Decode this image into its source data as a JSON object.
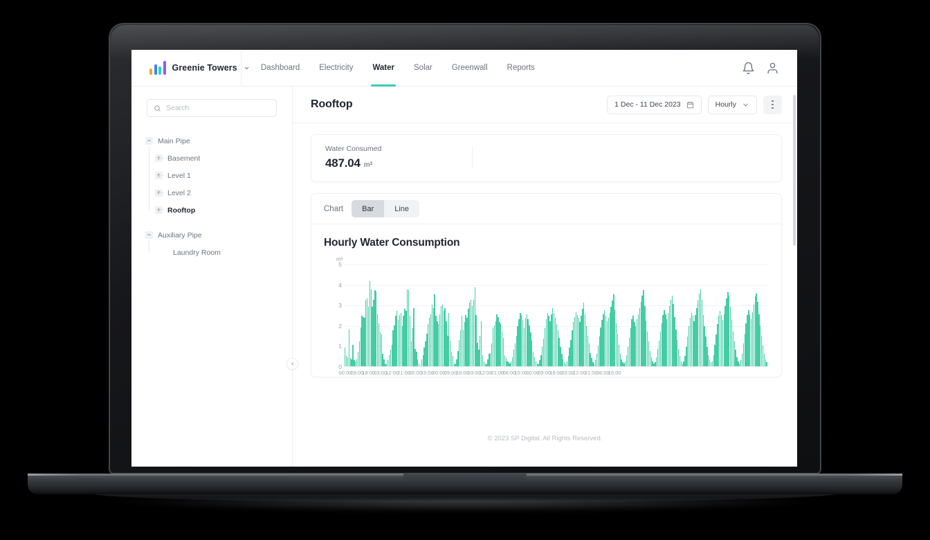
{
  "brand": {
    "name": "Greenie Towers",
    "caret_icon": "chevron-down-icon",
    "logo_icon": "bar-logo-icon"
  },
  "nav": {
    "links": [
      {
        "label": "Dashboard",
        "active": false
      },
      {
        "label": "Electricity",
        "active": false
      },
      {
        "label": "Water",
        "active": true
      },
      {
        "label": "Solar",
        "active": false
      },
      {
        "label": "Greenwall",
        "active": false
      },
      {
        "label": "Reports",
        "active": false
      }
    ],
    "notification_icon": "bell-icon",
    "account_icon": "user-icon"
  },
  "sidebar": {
    "search": {
      "placeholder": "Search",
      "value": "",
      "icon": "search-icon"
    },
    "tree": [
      {
        "label": "Main Pipe",
        "expander": "−",
        "selected": false,
        "children": [
          {
            "label": "Basement",
            "expander": "+",
            "selected": false
          },
          {
            "label": "Level 1",
            "expander": "+",
            "selected": false
          },
          {
            "label": "Level 2",
            "expander": "+",
            "selected": false
          },
          {
            "label": "Rooftop",
            "expander": "+",
            "selected": true
          }
        ]
      },
      {
        "label": "Auxiliary Pipe",
        "expander": "−",
        "selected": false,
        "leaves": [
          {
            "label": "Laundry Room"
          }
        ]
      }
    ],
    "collapse_icon": "chevron-left-icon"
  },
  "header": {
    "title": "Rooftop",
    "date_range": {
      "label": "1 Dec - 11 Dec 2023",
      "icon": "calendar-icon"
    },
    "granularity": {
      "label": "Hourly",
      "icon": "chevron-down-icon"
    },
    "more_menu": "kebab-menu-icon"
  },
  "kpi": {
    "label": "Water Consumed",
    "value": "487.04",
    "unit": "m³"
  },
  "chart_toolbar": {
    "label": "Chart",
    "options": [
      {
        "label": "Bar",
        "selected": true
      },
      {
        "label": "Line",
        "selected": false
      }
    ]
  },
  "footer": {
    "text": "© 2023 SP Digital. All Rights Reserved."
  },
  "chart_data": {
    "type": "bar",
    "title": "Hourly Water Consumption",
    "xlabel": "",
    "ylabel": "m³",
    "ylim": [
      0,
      5
    ],
    "yticks": [
      0,
      1,
      2,
      3,
      4,
      5
    ],
    "grid": true,
    "legend": false,
    "bar_color": "#45cca5",
    "xtick_labels": [
      "00:00",
      "09:00",
      "18:00",
      "03:00",
      "12:00",
      "21:00",
      "06:00",
      "15:00",
      "00:00",
      "09:00",
      "18:00",
      "03:00",
      "12:00",
      "21:00",
      "06:00",
      "15:00",
      "00:00",
      "09:00",
      "18:00",
      "03:00",
      "12:00",
      "21:00",
      "06:00",
      "15:00"
    ],
    "xtick_step_hours": 9,
    "series_name": "Water consumption",
    "values": [
      0.9,
      0.5,
      0.45,
      1.8,
      0.4,
      0.35,
      1.05,
      0.3,
      0.25,
      0.35,
      0.7,
      1.2,
      1.9,
      2.45,
      2.4,
      2.35,
      3.2,
      3.3,
      2.9,
      4.15,
      3.75,
      2.9,
      3.25,
      3.7,
      3.65,
      2.55,
      2.1,
      1.65,
      1.55,
      0.6,
      0.35,
      0.1,
      0.15,
      0.3,
      0.55,
      0.8,
      1.05,
      1.75,
      2.0,
      2.45,
      2.7,
      2.25,
      2.5,
      2.6,
      1.95,
      2.45,
      2.8,
      2.7,
      3.75,
      3.7,
      2.45,
      1.2,
      1.85,
      2.85,
      0.85,
      0.7,
      0.35,
      0.15,
      0.05,
      0.35,
      0.55,
      0.9,
      1.2,
      1.6,
      2.05,
      2.35,
      2.55,
      3.0,
      2.85,
      3.5,
      2.45,
      2.2,
      2.05,
      2.55,
      2.95,
      3.0,
      2.7,
      2.85,
      2.2,
      1.5,
      2.6,
      1.25,
      0.7,
      0.5,
      0.15,
      0.1,
      0.35,
      0.75,
      1.3,
      1.75,
      2.45,
      1.8,
      2.15,
      2.5,
      2.35,
      2.8,
      3.1,
      3.25,
      2.95,
      3.25,
      3.85,
      2.5,
      1.15,
      0.8,
      1.5,
      2.2,
      0.55,
      0.25,
      0.15,
      0.1,
      0.35,
      0.6,
      0.65,
      1.1,
      1.9,
      2.0,
      2.2,
      2.55,
      2.4,
      2.15,
      2.05,
      1.7,
      1.4,
      0.55,
      0.4,
      0.25,
      0.2,
      0.15,
      0.25,
      0.45,
      0.8,
      1.1,
      1.5,
      1.95,
      2.3,
      2.6,
      2.5,
      2.25,
      1.85,
      2.35,
      2.55,
      2.3,
      2.0,
      1.65,
      1.25,
      0.7,
      0.45,
      0.25,
      0.15,
      0.1,
      0.3,
      0.55,
      0.95,
      1.35,
      1.85,
      2.3,
      2.6,
      2.45,
      2.2,
      2.55,
      2.85,
      2.6,
      2.35,
      2.05,
      1.75,
      1.4,
      0.95,
      0.6,
      0.35,
      0.2,
      0.15,
      0.25,
      0.5,
      0.9,
      1.3,
      1.75,
      2.15,
      2.4,
      2.65,
      2.5,
      2.35,
      2.15,
      2.45,
      2.8,
      3.1,
      2.55,
      1.95,
      1.5,
      1.1,
      0.65,
      0.4,
      0.2,
      0.15,
      0.3,
      0.6,
      1.0,
      1.45,
      1.9,
      2.25,
      2.55,
      2.75,
      2.45,
      2.2,
      2.35,
      2.6,
      2.9,
      3.2,
      3.5,
      2.75,
      2.1,
      1.6,
      1.05,
      0.6,
      0.35,
      0.2,
      0.15,
      0.25,
      0.55,
      0.95,
      1.4,
      1.85,
      2.3,
      2.45,
      2.15,
      1.95,
      2.3,
      2.55,
      2.85,
      3.15,
      3.45,
      3.7,
      2.95,
      2.2,
      1.7,
      1.2,
      0.75,
      0.45,
      0.25,
      0.15,
      0.2,
      0.45,
      0.85,
      1.25,
      1.7,
      2.1,
      2.5,
      2.75,
      2.55,
      2.3,
      2.6,
      2.95,
      3.25,
      3.45,
      3.05,
      2.4,
      1.8,
      1.3,
      0.85,
      0.5,
      0.25,
      0.15,
      0.25,
      0.5,
      0.95,
      1.45,
      1.95,
      2.35,
      2.6,
      2.45,
      2.2,
      2.5,
      2.85,
      3.2,
      3.55,
      3.75,
      3.25,
      2.5,
      1.95,
      1.45,
      0.95,
      0.55,
      0.3,
      0.2,
      0.25,
      0.55,
      1.05,
      1.55,
      2.05,
      2.45,
      2.7,
      2.5,
      2.25,
      2.55,
      2.95,
      3.3,
      3.6,
      3.45,
      2.9,
      2.25,
      1.7,
      1.2,
      0.8,
      0.45,
      0.25,
      0.15,
      0.3,
      0.6,
      1.1,
      1.6,
      2.1,
      2.5,
      2.75,
      2.55,
      2.3,
      2.65,
      3.0,
      3.4,
      3.55,
      3.15,
      2.55,
      2.0,
      1.5,
      1.0,
      0.6,
      0.35,
      0.2
    ]
  }
}
